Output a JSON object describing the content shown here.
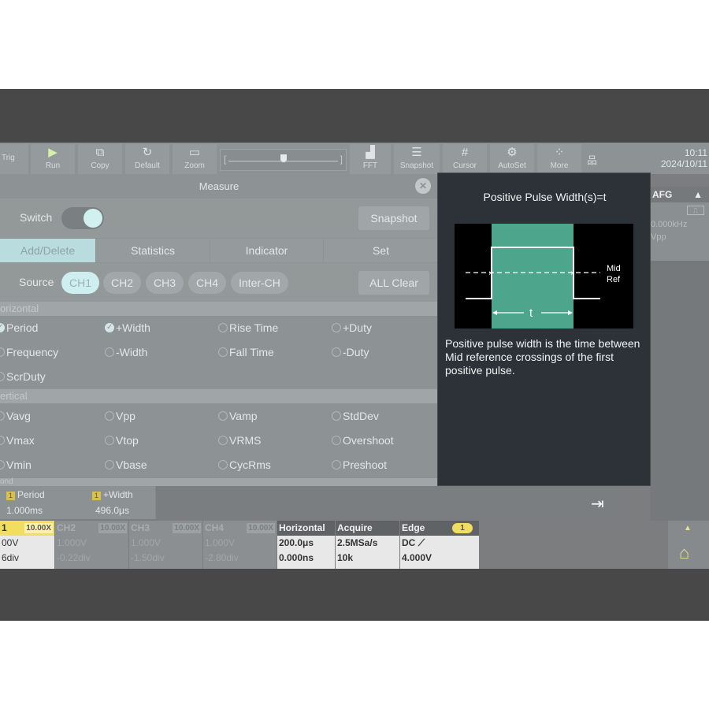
{
  "toolbar": {
    "buttons": [
      {
        "label": "Trig",
        "icon": "trig-icon"
      },
      {
        "label": "Run",
        "icon": "play-icon"
      },
      {
        "label": "Copy",
        "icon": "copy-icon"
      },
      {
        "label": "Default",
        "icon": "default-icon"
      },
      {
        "label": "Zoom",
        "icon": "zoom-icon"
      },
      {
        "label": "FFT",
        "icon": "fft-icon"
      },
      {
        "label": "Snapshot",
        "icon": "snapshot-icon"
      },
      {
        "label": "Cursor",
        "icon": "cursor-icon"
      },
      {
        "label": "AutoSet",
        "icon": "autoset-icon"
      },
      {
        "label": "More",
        "icon": "more-icon"
      }
    ],
    "time": "10:11",
    "date": "2024/10/11"
  },
  "measure": {
    "title": "Measure",
    "switch_label": "Switch",
    "snapshot_label": "Snapshot",
    "tabs": [
      "Add/Delete",
      "Statistics",
      "Indicator",
      "Set"
    ],
    "source_label": "Source",
    "sources": [
      "CH1",
      "CH2",
      "CH3",
      "CH4",
      "Inter-CH"
    ],
    "all_clear_label": "ALL Clear",
    "section_horizontal": "orizontal",
    "section_vertical": "ertical",
    "section_next": "ond",
    "horizontal_options": [
      [
        "Period",
        "+Width",
        "Rise Time",
        "+Duty"
      ],
      [
        "Frequency",
        "-Width",
        "Fall Time",
        "-Duty"
      ],
      [
        "ScrDuty"
      ]
    ],
    "vertical_options": [
      [
        "Vavg",
        "Vpp",
        "Vamp",
        "StdDev"
      ],
      [
        "Vmax",
        "Vtop",
        "VRMS",
        "Overshoot"
      ],
      [
        "Vmin",
        "Vbase",
        "CycRms",
        "Preshoot"
      ]
    ]
  },
  "info": {
    "title": "Positive Pulse Width(s)=t",
    "diagram_mid": "Mid",
    "diagram_ref": "Ref",
    "diagram_t": "t",
    "description": "Positive pulse width is the time between Mid reference crossings of the first positive pulse.",
    "pulse_color": "#4da58c"
  },
  "afg": {
    "label": "AFG",
    "freq": "0.000kHz",
    "amp": "Vpp"
  },
  "readouts": [
    {
      "num": "1",
      "name": "Period",
      "value": "1.000ms"
    },
    {
      "num": "1",
      "name": "+Width",
      "value": "496.0μs"
    }
  ],
  "channels": [
    {
      "name": "1",
      "scale": "10.00X",
      "v": "00V",
      "div": "6div"
    },
    {
      "name": "CH2",
      "scale": "10.00X",
      "v": "1.000V",
      "div": "-0.22div"
    },
    {
      "name": "CH3",
      "scale": "10.00X",
      "v": "1.000V",
      "div": "-1.50div"
    },
    {
      "name": "CH4",
      "scale": "10.00X",
      "v": "1.000V",
      "div": "-2.80div"
    }
  ],
  "horizontal": {
    "label": "Horizontal",
    "timebase": "200.0μs",
    "offset": "0.000ns"
  },
  "acquire": {
    "label": "Acquire",
    "rate": "2.5MSa/s",
    "depth": "10k"
  },
  "trigger": {
    "label": "Edge",
    "num": "1",
    "coupling": "DC",
    "level": "4.000V"
  }
}
